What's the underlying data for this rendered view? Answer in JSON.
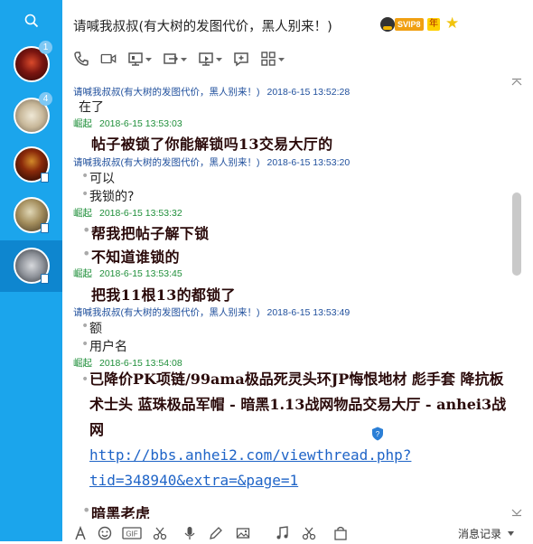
{
  "window": {
    "title": "请喊我叔叔(有大树的发图代价，黑人别来！)",
    "vip_badge": "SVIP8",
    "vip_year": "年"
  },
  "sidebar": {
    "contacts": [
      {
        "badge": "1"
      },
      {
        "badge": "4"
      },
      {
        "badge": ""
      },
      {
        "badge": ""
      },
      {
        "badge": ""
      }
    ]
  },
  "colors": {
    "sidebar": "#1ba5ec",
    "sidebar_selected": "#0e86cf",
    "other_name": "#1f4f9c",
    "my_name": "#1f8f3a",
    "link": "#1f64c7"
  },
  "icons": [
    "search-icon",
    "phone-icon",
    "video-icon",
    "screen-share-icon",
    "file-transfer-icon",
    "remote-desktop-icon",
    "add-chat-icon",
    "apps-icon",
    "font-icon",
    "emoji-icon",
    "gif-icon",
    "scissors-icon",
    "voice-icon",
    "draw-icon",
    "image-icon",
    "music-icon",
    "shield-icon"
  ],
  "messages": {
    "m1": {
      "sender": "请喊我叔叔(有大树的发图代价，黑人别来！)",
      "time": "2018-6-15 13:52:28",
      "lines": [
        "在了"
      ]
    },
    "m2": {
      "sender": "崛起",
      "time": "2018-6-15 13:53:03",
      "lines": [
        "帖子被锁了你能解锁吗13交易大厅的"
      ]
    },
    "m3": {
      "sender": "请喊我叔叔(有大树的发图代价，黑人别来！)",
      "time": "2018-6-15 13:53:20",
      "lines": [
        "可以",
        "我锁的?"
      ]
    },
    "m4": {
      "sender": "崛起",
      "time": "2018-6-15 13:53:32",
      "lines": [
        "帮我把帖子解下锁",
        "不知道谁锁的"
      ]
    },
    "m5": {
      "sender": "崛起",
      "time": "2018-6-15 13:53:45",
      "lines": [
        "把我11根13的都锁了"
      ]
    },
    "m6": {
      "sender": "请喊我叔叔(有大树的发图代价，黑人别来！)",
      "time": "2018-6-15 13:53:49",
      "lines": [
        "额",
        "用户名"
      ]
    },
    "m7": {
      "sender": "崛起",
      "time": "2018-6-15 13:54:08",
      "text": "已降价PK项链/99ama极品死灵头环JP悔恨地材 彪手套 降抗板 术士头 蓝珠极品军帽 - 暗黑1.13战网物品交易大厅 - anhei3战网",
      "link": "http://bbs.anhei2.com/viewthread.php?tid=348940&extra=&page=1",
      "next": "暗黑老虎"
    }
  },
  "bottom_bar": {
    "history": "消息记录"
  }
}
